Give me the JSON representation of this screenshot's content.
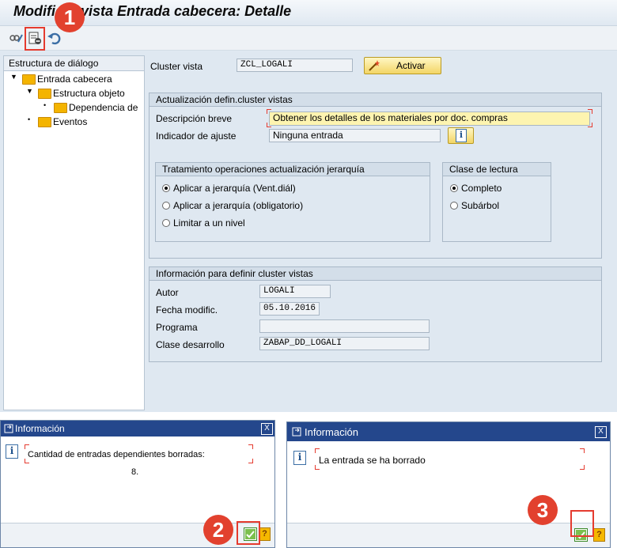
{
  "window": {
    "title": "Modificar vista Entrada cabecera: Detalle"
  },
  "toolbar": {
    "icons": [
      "display-change-icon",
      "delete-icon",
      "undo-icon"
    ]
  },
  "tree": {
    "header": "Estructura de diálogo",
    "items": [
      {
        "label": "Entrada cabecera",
        "expanded": true
      },
      {
        "label": "Estructura objeto",
        "expanded": true
      },
      {
        "label": "Dependencia de"
      },
      {
        "label": "Eventos"
      }
    ]
  },
  "cluster": {
    "label": "Cluster vista",
    "value": "ZCL_LOGALI",
    "activate_label": "Activar"
  },
  "maint": {
    "title": "Actualización defin.cluster vistas",
    "desc_label": "Descripción breve",
    "desc_value": "Obtener los detalles de los materiales por doc. compras",
    "adj_label": "Indicador de ajuste",
    "adj_value": "Ninguna entrada"
  },
  "hier": {
    "title": "Tratamiento operaciones actualización jerarquía",
    "options": [
      "Aplicar a jerarquía (Vent.diál)",
      "Aplicar a jerarquía (obligatorio)",
      "Limitar a un nivel"
    ],
    "selected": 0
  },
  "read": {
    "title": "Clase de lectura",
    "options": [
      "Completo",
      "Subárbol"
    ],
    "selected": 0
  },
  "info": {
    "title": "Información para definir cluster vistas",
    "author_label": "Autor",
    "author_value": "LOGALI",
    "date_label": "Fecha modific.",
    "date_value": "05.10.2016",
    "program_label": "Programa",
    "program_value": "",
    "pkg_label": "Clase desarrollo",
    "pkg_value": "ZABAP_DD_LOGALI"
  },
  "dialog1": {
    "title": "Información",
    "message": "Cantidad de entradas dependientes borradas:",
    "count": "8."
  },
  "dialog2": {
    "title": "Información",
    "message": "La entrada se ha borrado"
  },
  "badges": [
    "1",
    "2",
    "3"
  ],
  "colors": {
    "badge": "#e2412e",
    "highlight": "#e53b2f",
    "dialog_title": "#24478c",
    "desc_field": "#fdf4b0"
  }
}
